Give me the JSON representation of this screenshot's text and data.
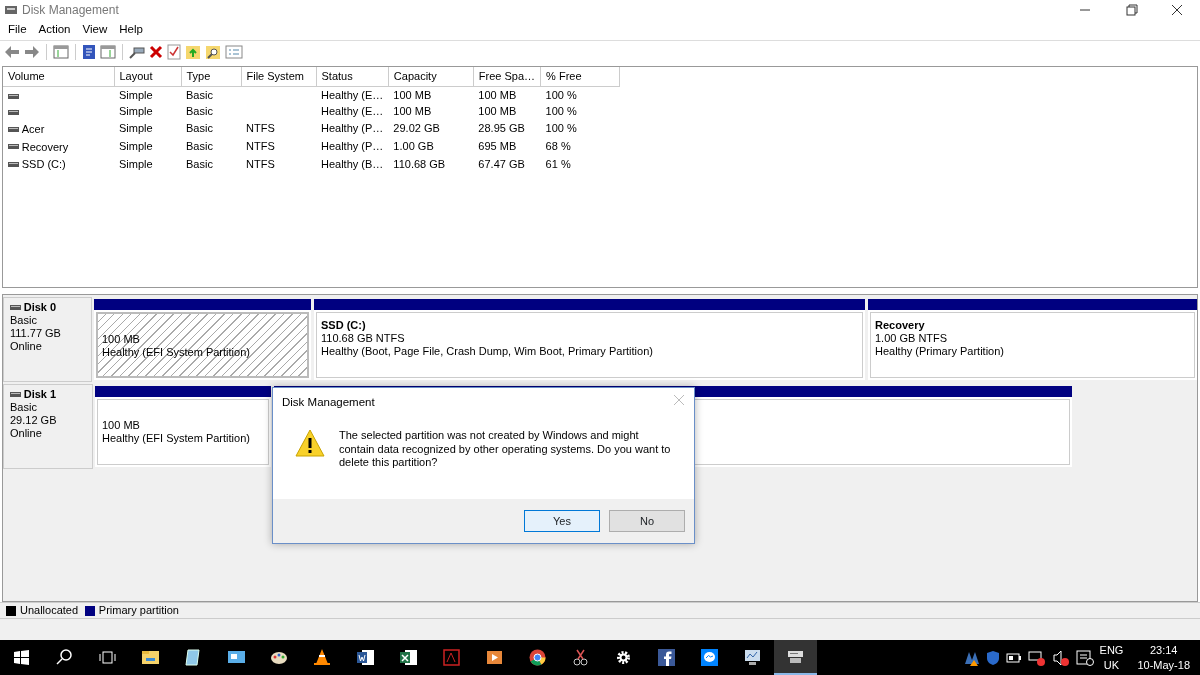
{
  "window": {
    "title": "Disk Management"
  },
  "menu": [
    "File",
    "Action",
    "View",
    "Help"
  ],
  "volume_table": {
    "columns": [
      "Volume",
      "Layout",
      "Type",
      "File System",
      "Status",
      "Capacity",
      "Free Spa…",
      "% Free"
    ],
    "rows": [
      [
        "",
        "Simple",
        "Basic",
        "",
        "Healthy (E…",
        "100 MB",
        "100 MB",
        "100 %"
      ],
      [
        "",
        "Simple",
        "Basic",
        "",
        "Healthy (E…",
        "100 MB",
        "100 MB",
        "100 %"
      ],
      [
        "Acer",
        "Simple",
        "Basic",
        "NTFS",
        "Healthy (P…",
        "29.02 GB",
        "28.95 GB",
        "100 %"
      ],
      [
        "Recovery",
        "Simple",
        "Basic",
        "NTFS",
        "Healthy (P…",
        "1.00 GB",
        "695 MB",
        "68 %"
      ],
      [
        "SSD (C:)",
        "Simple",
        "Basic",
        "NTFS",
        "Healthy (B…",
        "110.68 GB",
        "67.47 GB",
        "61 %"
      ]
    ]
  },
  "disks": [
    {
      "name": "Disk 0",
      "type": "Basic",
      "size": "111.77 GB",
      "state": "Online",
      "partitions": [
        {
          "size": "100 MB",
          "status": "Healthy (EFI System Partition)",
          "selected": true
        },
        {
          "name": "SSD  (C:)",
          "size": "110.68 GB NTFS",
          "status": "Healthy (Boot, Page File, Crash Dump, Wim Boot, Primary Partition)",
          "selected": false
        },
        {
          "name": "Recovery",
          "size": "1.00 GB NTFS",
          "status": "Healthy (Primary Partition)",
          "selected": false
        }
      ]
    },
    {
      "name": "Disk 1",
      "type": "Basic",
      "size": "29.12 GB",
      "state": "Online",
      "partitions": [
        {
          "size": "100 MB",
          "status": "Healthy (EFI System Partition)",
          "selected": false
        },
        {
          "selected": false
        }
      ]
    }
  ],
  "legend": [
    {
      "label": "Unallocated",
      "color": "#000000"
    },
    {
      "label": "Primary partition",
      "color": "#000080"
    }
  ],
  "dialog": {
    "title": "Disk Management",
    "message": "The selected partition was not created by Windows and might contain data recognized by other operating systems. Do you want to delete this partition?",
    "buttons": [
      {
        "label": "Yes",
        "selected": true
      },
      {
        "label": "No",
        "selected": false
      }
    ]
  },
  "taskbar": {
    "apps": [
      {
        "selected": false
      },
      {
        "selected": false
      },
      {
        "selected": false
      },
      {
        "selected": false
      },
      {
        "selected": false
      },
      {
        "selected": false
      },
      {
        "selected": false
      },
      {
        "selected": false
      },
      {
        "selected": false
      },
      {
        "selected": false
      },
      {
        "selected": false
      },
      {
        "selected": false
      },
      {
        "selected": false
      },
      {
        "selected": false
      },
      {
        "selected": false
      },
      {
        "selected": true
      }
    ],
    "language": "ENG",
    "region": "UK",
    "time": "23:14",
    "date": "10-May-18"
  }
}
